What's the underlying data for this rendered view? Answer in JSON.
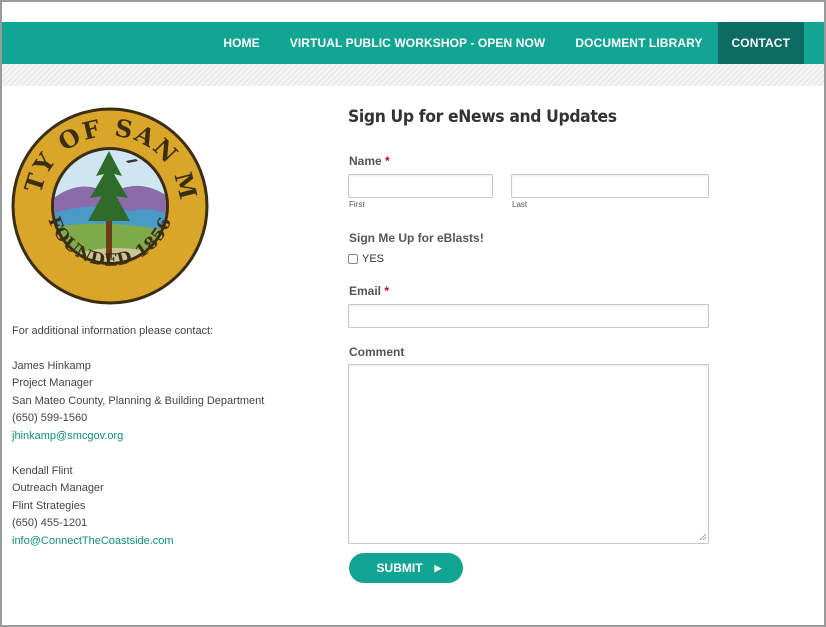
{
  "nav": {
    "items": [
      {
        "label": "HOME"
      },
      {
        "label": "VIRTUAL PUBLIC WORKSHOP - OPEN NOW"
      },
      {
        "label": "DOCUMENT LIBRARY"
      },
      {
        "label": "CONTACT",
        "active": true
      }
    ]
  },
  "seal": {
    "top_text": "COUNTY OF SAN MATEO",
    "bottom_text": "FOUNDED 1856"
  },
  "contact": {
    "intro": "For additional information please contact:",
    "people": [
      {
        "name": "James Hinkamp",
        "title": "Project Manager",
        "org": "San Mateo County, Planning & Building Department",
        "phone": "(650) 599-1560",
        "email": "jhinkamp@smcgov.org"
      },
      {
        "name": "Kendall Flint",
        "title": "Outreach Manager",
        "org": "Flint Strategies",
        "phone": "(650) 455-1201",
        "email": "info@ConnectTheCoastside.com"
      }
    ]
  },
  "form": {
    "title": "Sign Up for eNews and Updates",
    "name_label": "Name",
    "required_mark": "*",
    "first_sublabel": "First",
    "last_sublabel": "Last",
    "first_value": "",
    "last_value": "",
    "eblast_label": "Sign Me Up for eBlasts!",
    "eblast_option": "YES",
    "eblast_checked": false,
    "email_label": "Email",
    "email_value": "",
    "comment_label": "Comment",
    "comment_value": "",
    "submit_label": "SUBMIT",
    "submit_icon": "triangle-right-icon"
  },
  "colors": {
    "brand_teal": "#12a593",
    "active_nav": "#0c6b63",
    "link": "#0e8f80",
    "required": "#d0021b"
  }
}
